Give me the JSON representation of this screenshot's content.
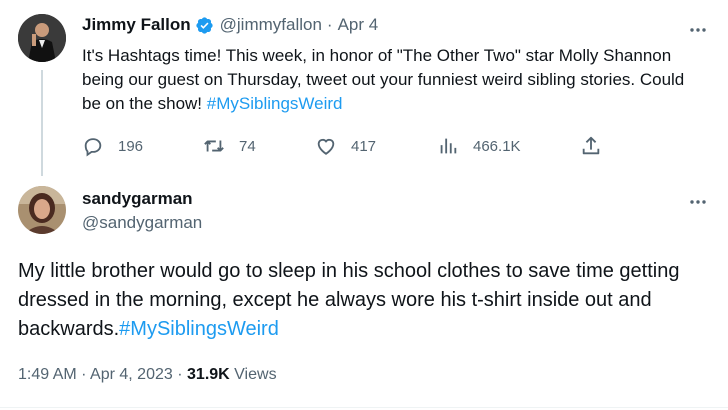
{
  "tweet1": {
    "name": "Jimmy Fallon",
    "handle": "@jimmyfallon",
    "separator": "·",
    "date": "Apr 4",
    "text_before": "It's Hashtags time! This week, in honor of \"The Other Two\" star Molly Shannon being our guest on Thursday, tweet out your funniest weird sibling stories. Could be on the show! ",
    "hashtag": "#MySiblingsWeird",
    "actions": {
      "replies": "196",
      "retweets": "74",
      "likes": "417",
      "views": "466.1K"
    },
    "more_icon": "more-dots-icon",
    "verified_icon": "verified-badge-icon"
  },
  "tweet2": {
    "name": "sandygarman",
    "handle": "@sandygarman",
    "text_before": "My little brother would go to sleep in his school clothes to save time getting dressed in the morning, except he always wore his t-shirt inside out and backwards.",
    "hashtag": "#MySiblingsWeird",
    "time": "1:49 AM",
    "dot1": "·",
    "date": "Apr 4, 2023",
    "dot2": "·",
    "views_count": "31.9K",
    "views_label": "Views"
  },
  "colors": {
    "link": "#1d9bf0",
    "secondary_text": "#536471",
    "verified": "#1d9bf0"
  }
}
